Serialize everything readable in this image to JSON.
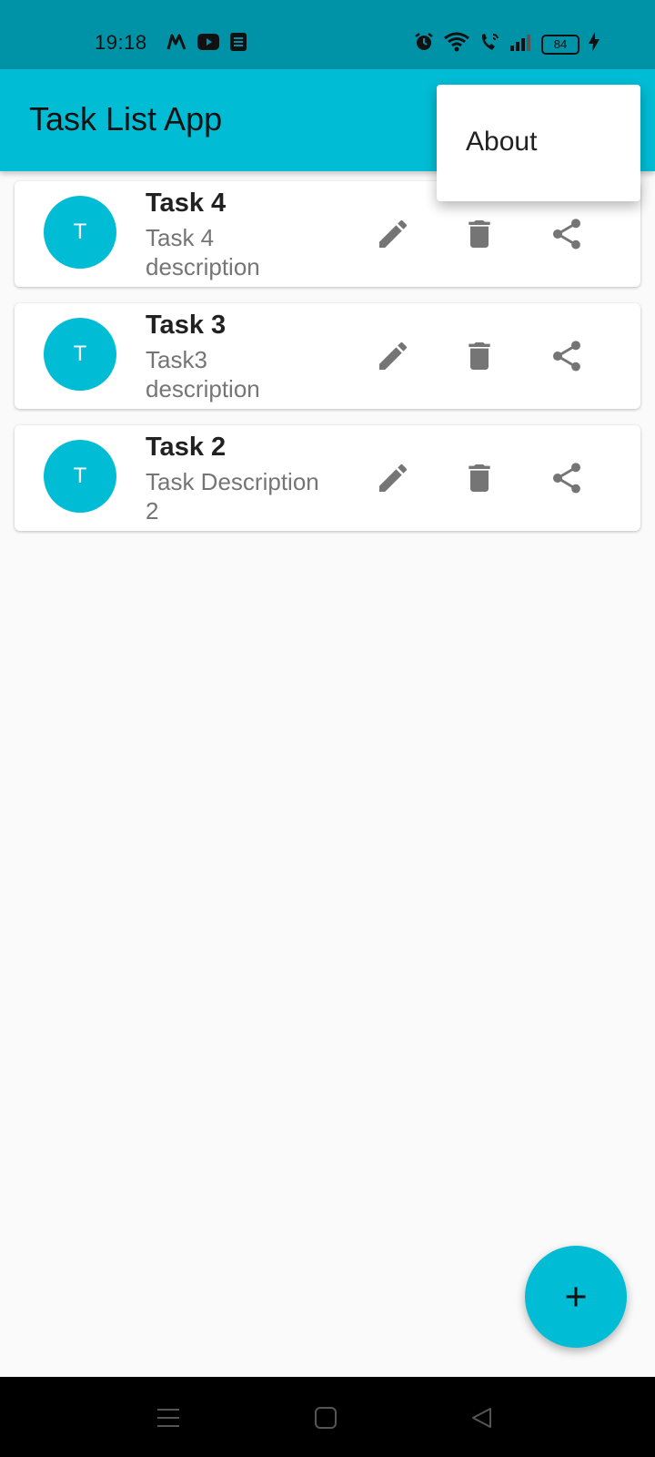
{
  "status_bar": {
    "time": "19:18",
    "battery_level": "84",
    "icons": [
      "myntra-icon",
      "youtube-icon",
      "notes-icon",
      "alarm-icon",
      "wifi-icon",
      "wifi-calling-icon",
      "signal-icon",
      "battery-icon",
      "charging-icon"
    ]
  },
  "app_bar": {
    "title": "Task List App"
  },
  "overflow_menu": {
    "items": [
      {
        "label": "About"
      }
    ]
  },
  "tasks": [
    {
      "avatar": "T",
      "title": "Task 4",
      "description": "Task 4 description"
    },
    {
      "avatar": "T",
      "title": "Task 3",
      "description": "Task3 description"
    },
    {
      "avatar": "T",
      "title": "Task 2",
      "description": "Task Description 2"
    }
  ],
  "task_actions": [
    "edit-icon",
    "delete-icon",
    "share-icon"
  ],
  "fab": {
    "icon": "add-icon"
  },
  "nav_bar": {
    "buttons": [
      "recents-icon",
      "home-icon",
      "back-icon"
    ]
  },
  "colors": {
    "primary": "#00bcd4",
    "status_bar": "#0093a8",
    "background": "#fafafa",
    "icon_gray": "#757575"
  }
}
